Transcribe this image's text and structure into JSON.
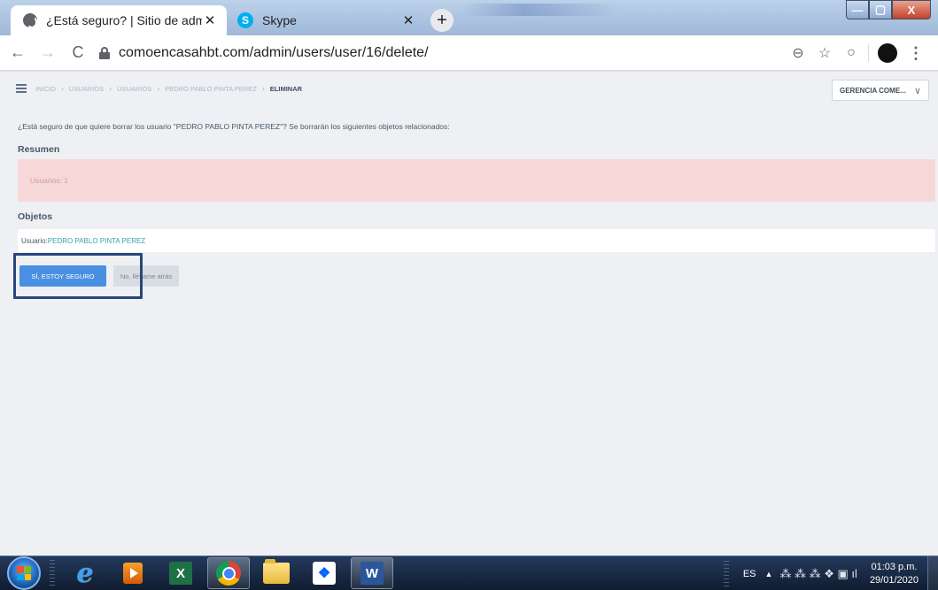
{
  "browser": {
    "tabs": [
      {
        "title": "¿Está seguro? | Sitio de administr",
        "close": "✕",
        "icon": "globe-icon"
      },
      {
        "title": "Skype",
        "close": "✕",
        "icon": "skype-icon",
        "favicon_letter": "S"
      }
    ],
    "new_tab": "+",
    "window_controls": {
      "minimize": "—",
      "maximize": "▢",
      "close": "X"
    },
    "nav": {
      "back": "←",
      "forward": "→",
      "reload": "C"
    },
    "url": "comoencasahbt.com/admin/users/user/16/delete/",
    "toolbar_icons": {
      "zoom": "⊖",
      "bookmark": "☆",
      "extension": "○",
      "menu": "⋮"
    }
  },
  "page": {
    "breadcrumb": [
      "Inicio",
      "Usuarios",
      "Usuarios",
      "Pedro Pablo Pinta Perez",
      "Eliminar"
    ],
    "breadcrumb_sep": "›",
    "department_select": {
      "value": "GERENCIA COME...",
      "chevron": "∨"
    },
    "confirm_message": "¿Está seguro de que quiere borrar los usuario \"PEDRO PABLO PINTA PEREZ\"? Se borrarán los siguientes objetos relacionados:",
    "summary_title": "Resumen",
    "summary_item": "Usuarios: 1",
    "objects_title": "Objetos",
    "object_prefix": "Usuario: ",
    "object_link": "PEDRO PABLO PINTA PEREZ",
    "confirm_button": "Sí, estoy seguro",
    "cancel_button": "No, llévame atrás"
  },
  "taskbar": {
    "apps": [
      "internet-explorer",
      "media-player",
      "excel",
      "chrome",
      "file-explorer",
      "dropbox",
      "word"
    ],
    "excel_letter": "X",
    "word_letter": "W",
    "dropbox_glyph": "❖",
    "ie_glyph": "e",
    "language": "ES",
    "tray_arrow": "▲",
    "tray_icons": "⁂ ⁂ ⁂ ❖ ▣ ıl",
    "time": "01:03 p.m.",
    "date": "29/01/2020"
  },
  "colors": {
    "primary_button": "#4a90e2",
    "summary_bg": "#f7d8d8",
    "link": "#3aa0b0",
    "highlight_frame": "#28467a"
  }
}
